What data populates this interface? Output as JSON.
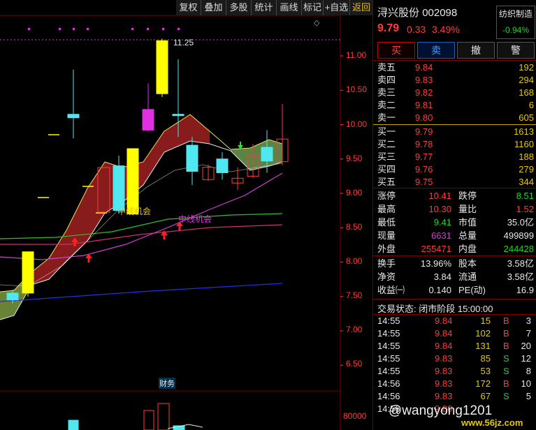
{
  "toolbar": {
    "buttons": [
      "复权",
      "叠加",
      "多股",
      "统计",
      "画线",
      "标记",
      "+自选",
      "返回"
    ]
  },
  "chart": {
    "price_labels": [
      "11.00",
      "10.50",
      "10.00",
      "9.50",
      "9.00",
      "8.50",
      "8.00",
      "7.50",
      "7.00",
      "6.50"
    ],
    "volume_label": "80000",
    "high_label": "11.25",
    "signal_labels": [
      "中线机会",
      "中线机会"
    ],
    "indicator_tab": "财务"
  },
  "chart_data": {
    "type": "candlestick",
    "y_axis_ticks": [
      11.0,
      10.5,
      10.0,
      9.5,
      9.0,
      8.5,
      8.0,
      7.5,
      7.0,
      6.5
    ],
    "candles": [
      {
        "o": 7.45,
        "c": 7.55,
        "h": 7.6,
        "l": 7.4,
        "color": "cyan"
      },
      {
        "o": 7.55,
        "c": 8.15,
        "h": 8.15,
        "l": 7.5,
        "color": "yellow"
      },
      {
        "o": 9.4,
        "c": 8.75,
        "h": 9.55,
        "l": 8.7,
        "color": "cyan"
      },
      {
        "o": 8.7,
        "c": 9.65,
        "h": 9.65,
        "l": 8.7,
        "color": "yellow"
      },
      {
        "o": 10.15,
        "c": 10.1,
        "h": 10.8,
        "l": 9.8,
        "color": "cyan"
      },
      {
        "o": 10.45,
        "c": 11.22,
        "h": 11.25,
        "l": 10.4,
        "color": "yellow"
      },
      {
        "o": 9.92,
        "c": 10.22,
        "h": 10.6,
        "l": 9.9,
        "color": "magenta"
      },
      {
        "o": 10.15,
        "c": 10.13,
        "h": 10.95,
        "l": 9.82,
        "color": "cyan"
      },
      {
        "o": 9.7,
        "c": 9.32,
        "h": 9.82,
        "l": 9.12,
        "color": "cyan"
      },
      {
        "o": 9.2,
        "c": 9.38,
        "h": 9.42,
        "l": 9.18,
        "color": "red"
      },
      {
        "o": 9.5,
        "c": 9.3,
        "h": 9.6,
        "l": 9.2,
        "color": "cyan"
      },
      {
        "o": 9.22,
        "c": 9.15,
        "h": 9.38,
        "l": 9.05,
        "color": "red"
      },
      {
        "o": 9.25,
        "c": 9.55,
        "h": 9.72,
        "l": 9.22,
        "color": "red"
      },
      {
        "o": 9.67,
        "c": 9.47,
        "h": 9.92,
        "l": 9.3,
        "color": "cyan"
      },
      {
        "o": 9.46,
        "c": 9.79,
        "h": 10.3,
        "l": 9.41,
        "color": "red"
      }
    ]
  },
  "stock": {
    "name": "浔兴股份",
    "code": "002098",
    "industry": "纺织制造",
    "price": "9.79",
    "change": "0.33",
    "change_pct": "3.49%",
    "industry_pct": "-0.94%"
  },
  "trade_buttons": [
    "买",
    "卖",
    "撤",
    "警"
  ],
  "order_book": {
    "sells": [
      {
        "label": "卖五",
        "price": "9.84",
        "vol": "192"
      },
      {
        "label": "卖四",
        "price": "9.83",
        "vol": "294"
      },
      {
        "label": "卖三",
        "price": "9.82",
        "vol": "168"
      },
      {
        "label": "卖二",
        "price": "9.81",
        "vol": "6"
      },
      {
        "label": "卖一",
        "price": "9.80",
        "vol": "605"
      }
    ],
    "buys": [
      {
        "label": "买一",
        "price": "9.79",
        "vol": "1613"
      },
      {
        "label": "买二",
        "price": "9.78",
        "vol": "1160"
      },
      {
        "label": "买三",
        "price": "9.77",
        "vol": "188"
      },
      {
        "label": "买四",
        "price": "9.76",
        "vol": "279"
      },
      {
        "label": "买五",
        "price": "9.75",
        "vol": "344"
      }
    ]
  },
  "stats1": [
    {
      "l1": "涨停",
      "v1": "10.41",
      "l2": "跌停",
      "v2": "8.51"
    },
    {
      "l1": "最高",
      "v1": "10.30",
      "l2": "量比",
      "v2": "1.52"
    },
    {
      "l1": "最低",
      "v1": "9.41",
      "l2": "市值",
      "v2": "35.0亿"
    },
    {
      "l1": "现量",
      "v1": "6631",
      "l2": "总量",
      "v2": "499899"
    },
    {
      "l1": "外盘",
      "v1": "255471",
      "l2": "内盘",
      "v2": "244428"
    }
  ],
  "stats2": [
    {
      "l1": "换手",
      "v1": "13.96%",
      "l2": "股本",
      "v2": "3.58亿"
    },
    {
      "l1": "净资",
      "v1": "3.84",
      "l2": "流通",
      "v2": "3.58亿"
    },
    {
      "l1": "收益㈠",
      "v1": "0.140",
      "l2": "PE(动)",
      "v2": "16.9"
    }
  ],
  "trade_status": "交易状态: 闭市阶段 15:00:00",
  "ticks": [
    {
      "time": "14:55",
      "price": "9.84",
      "vol": "15",
      "side": "B",
      "n": "3"
    },
    {
      "time": "14:55",
      "price": "9.84",
      "vol": "102",
      "side": "B",
      "n": "7"
    },
    {
      "time": "14:55",
      "price": "9.84",
      "vol": "131",
      "side": "B",
      "n": "20"
    },
    {
      "time": "14:55",
      "price": "9.83",
      "vol": "85",
      "side": "S",
      "n": "12"
    },
    {
      "time": "14:55",
      "price": "9.83",
      "vol": "53",
      "side": "S",
      "n": "8"
    },
    {
      "time": "14:56",
      "price": "9.83",
      "vol": "172",
      "side": "B",
      "n": "10"
    },
    {
      "time": "14:56",
      "price": "9.83",
      "vol": "67",
      "side": "S",
      "n": "5"
    },
    {
      "time": "14:56",
      "price": "9.80",
      "vol": "",
      "side": "",
      "n": ""
    }
  ],
  "watermark": "@wangyong1201",
  "watermark2": "www.56jz.com"
}
